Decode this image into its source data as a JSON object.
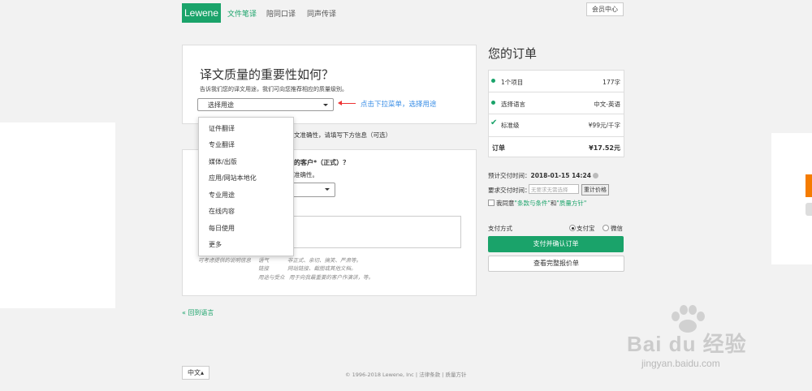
{
  "header": {
    "logo": "Lewene",
    "nav": [
      "文件笔译",
      "陪同口译",
      "同声传译"
    ],
    "member_button": "会员中心"
  },
  "form": {
    "title": "译文质量的重要性如何？",
    "subtitle": "告诉我们您的译文用途，我们可向您推荐相应的质量级别。",
    "select_label": "选择用途",
    "hint": "点击下拉菜单，选择用途",
    "info_line": "文准确性，请填写下方信息（可选）",
    "q2_title": "的客户*（正式）？",
    "q2_sub": "准确性。",
    "note_left": "可考虑提供的说明信息",
    "note_rows": [
      [
        "语气",
        "非正式、亲切、搞笑、严肃等。"
      ],
      [
        "链接",
        "网站链接、截图或其他文档。"
      ],
      [
        "用途与受众",
        "用于向我最重要的客户作演讲，等。"
      ]
    ]
  },
  "dropdown": {
    "items": [
      "证件翻译",
      "专业翻译",
      "媒体/出版",
      "应用/网站本地化",
      "专业用途",
      "在线内容",
      "每日使用",
      "更多"
    ]
  },
  "back_link": "« 回到语言",
  "order": {
    "title": "您的订单",
    "rows": [
      {
        "label": "1个项目",
        "value": "177字"
      },
      {
        "label": "选择语言",
        "value": "中文-英语"
      },
      {
        "label": "标准级",
        "value": "¥99元/千字"
      }
    ],
    "total_label": "订单",
    "total_value": "¥17.52元",
    "delivery_label": "预计交付时间：",
    "delivery_value": "2018-01-15 14:24",
    "request_label": "要求交付时间：",
    "request_placeholder": "无要求无需选择",
    "recalc_label": "重计价格",
    "agree_prefix": "我同意",
    "agree_terms": "\"条款与条件\"",
    "agree_and": "和",
    "agree_quality": "\"质量方针\"",
    "pay_label": "支付方式",
    "pay_options": [
      "支付宝",
      "微信"
    ],
    "pay_button": "支付并确认订单",
    "quote_button": "查看完整报价单"
  },
  "footer": {
    "lang": "中文▴",
    "copyright": "© 1996-2018 Lewene, Inc",
    "links": [
      "法律条款",
      "质量方针"
    ]
  },
  "watermark": {
    "text": "Bai du 经验",
    "url": "jingyan.baidu.com"
  },
  "colors": {
    "brand": "#1aa36a",
    "hint": "#3a8ee6",
    "arrow": "#e33333"
  }
}
